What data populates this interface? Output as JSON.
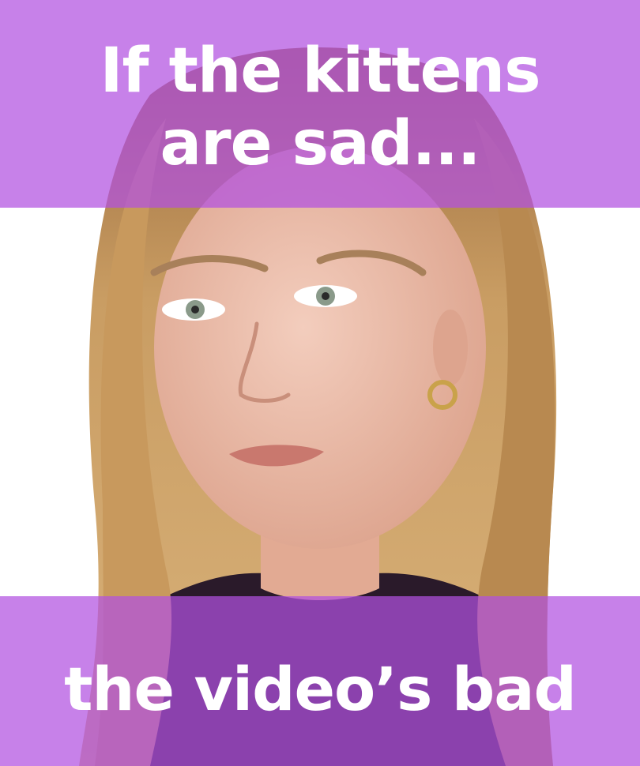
{
  "captions": {
    "top_line_1": "If the kittens",
    "top_line_2": "are sad...",
    "bottom": "the video’s bad"
  },
  "colors": {
    "banner": "#b250e0",
    "text": "#ffffff",
    "background": "#ffffff",
    "hair": "#c79a5e",
    "skin": "#e9b9a4",
    "sweater": "#2a1a2a"
  }
}
